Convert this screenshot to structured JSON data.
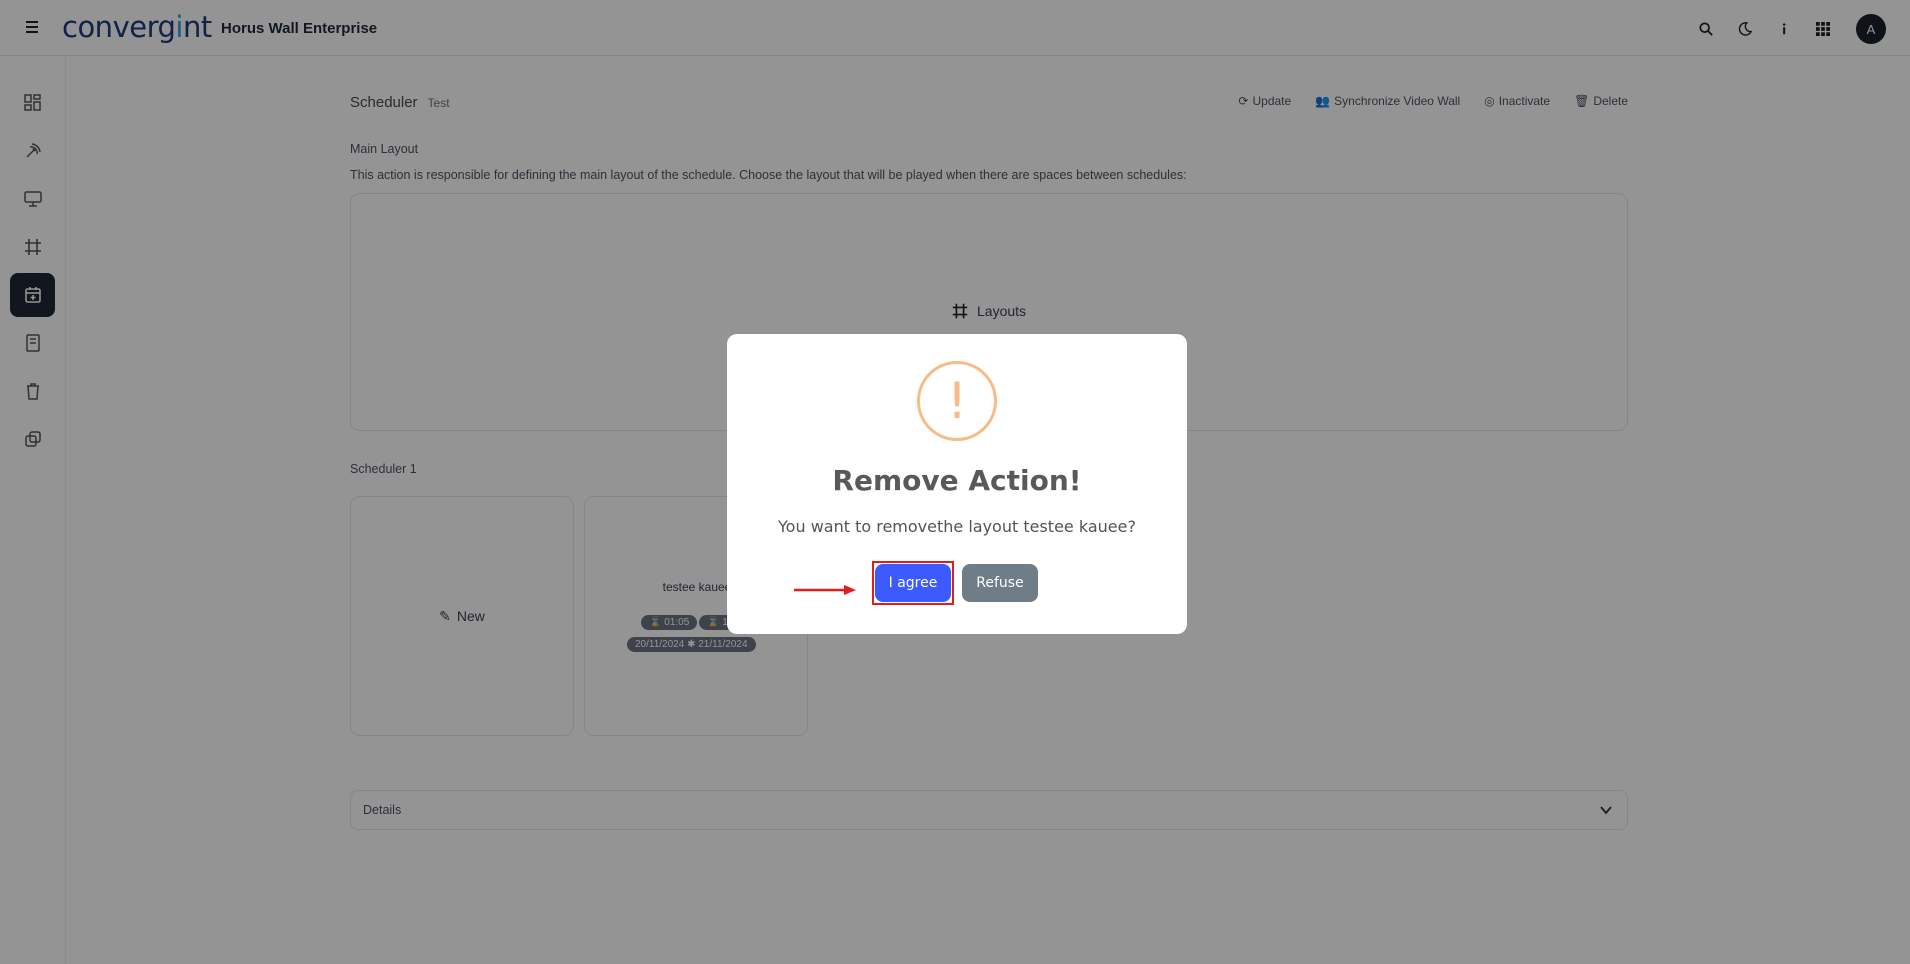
{
  "brand": {
    "logo_text_a": "converg",
    "logo_text_b": "i",
    "logo_text_c": "nt",
    "app_title": "Horus Wall Enterprise"
  },
  "header": {
    "avatar_letter": "A"
  },
  "sidebar": {
    "items": [
      {
        "name": "dashboard"
      },
      {
        "name": "broadcast"
      },
      {
        "name": "monitor"
      },
      {
        "name": "layouts"
      },
      {
        "name": "scheduler",
        "active": true
      },
      {
        "name": "reports"
      },
      {
        "name": "trash"
      },
      {
        "name": "copy"
      }
    ]
  },
  "page": {
    "title": "Scheduler",
    "subtitle": "Test",
    "actions": {
      "update": "Update",
      "sync": "Synchronize Video Wall",
      "inactivate": "Inactivate",
      "delete": "Delete"
    },
    "main_layout_label": "Main Layout",
    "main_layout_desc": "This action is responsible for defining the main layout of the schedule. Choose the layout that will be played when there are spaces between schedules:",
    "layouts_button": "Layouts",
    "scheduler_section": "Scheduler 1",
    "new_card": "New",
    "layout_card": {
      "name": "testee kauee",
      "tag_time_start": "01:05",
      "tag_time_end": "1",
      "tag_dates": "20/11/2024 ✱ 21/11/2024"
    },
    "details_label": "Details"
  },
  "modal": {
    "icon": "!",
    "title": "Remove Action!",
    "message": "You want to removethe layout testee kauee?",
    "agree_label": "I agree",
    "refuse_label": "Refuse"
  },
  "colors": {
    "agree": "#3d5afe",
    "refuse": "#6e7d88",
    "warning": "#f8bb86",
    "highlight": "#e11d1d",
    "sidebar_active": "#1f2735"
  }
}
